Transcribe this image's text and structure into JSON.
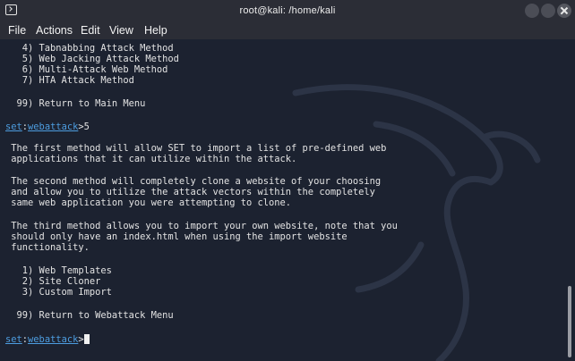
{
  "window": {
    "title": "root@kali: /home/kali"
  },
  "menu": [
    "File",
    "Actions",
    "Edit",
    "View",
    "Help"
  ],
  "terminal": {
    "lines": [
      "   4) Tabnabbing Attack Method",
      "   5) Web Jacking Attack Method",
      "   6) Multi-Attack Web Method",
      "   7) HTA Attack Method",
      "",
      "  99) Return to Main Menu",
      "",
      "",
      "",
      " The first method will allow SET to import a list of pre-defined web",
      " applications that it can utilize within the attack.",
      "",
      " The second method will completely clone a website of your choosing",
      " and allow you to utilize the attack vectors within the completely",
      " same web application you were attempting to clone.",
      "",
      " The third method allows you to import your own website, note that you",
      " should only have an index.html when using the import website",
      " functionality.",
      "",
      "   1) Web Templates",
      "   2) Site Cloner",
      "   3) Custom Import",
      "",
      "  99) Return to Webattack Menu",
      "",
      ""
    ],
    "prompt1": {
      "set": "set",
      "sep": ":",
      "module": "webattack",
      "caret": ">",
      "input": "5"
    },
    "prompt2": {
      "set": "set",
      "sep": ":",
      "module": "webattack",
      "caret": ">",
      "input": ""
    }
  },
  "colors": {
    "background": "#1c2230",
    "titlebar": "#2b2d36",
    "text": "#e3e3e3",
    "prompt": "#4d9de0"
  }
}
